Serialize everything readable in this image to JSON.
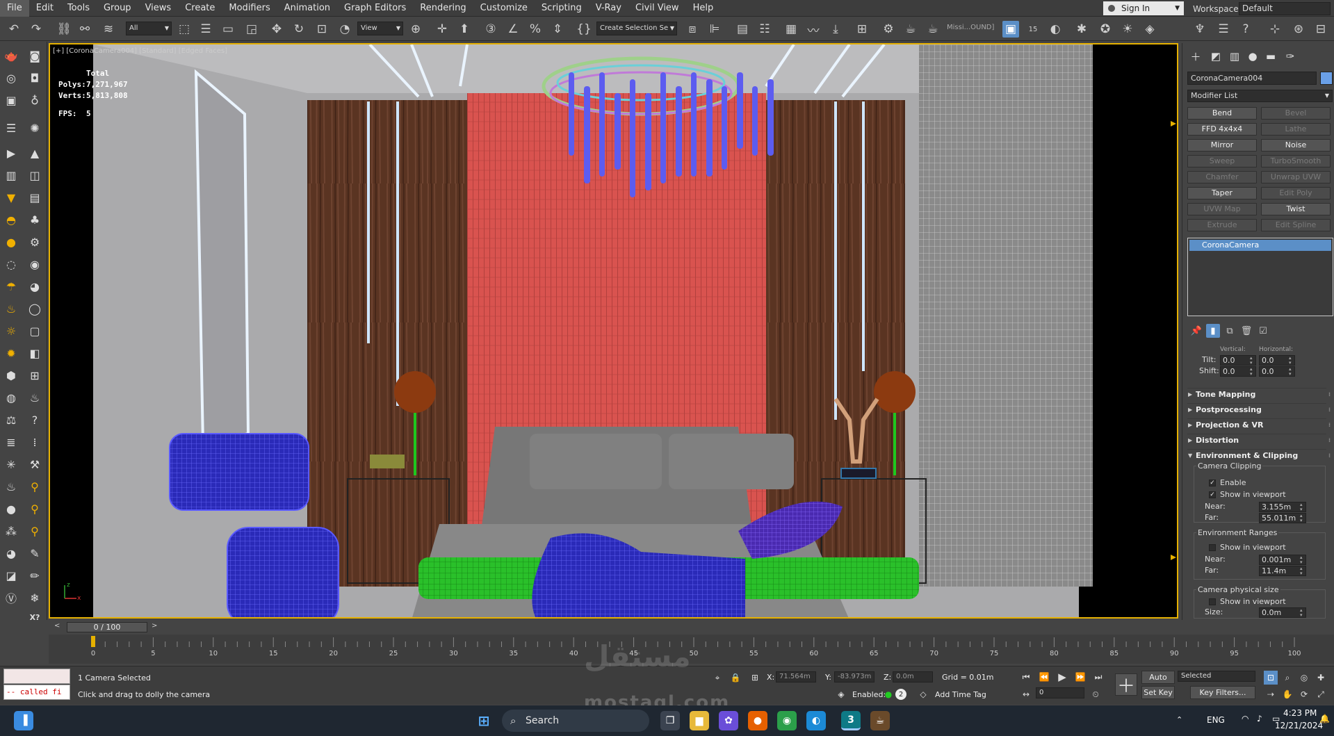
{
  "menu": [
    "File",
    "Edit",
    "Tools",
    "Group",
    "Views",
    "Create",
    "Modifiers",
    "Animation",
    "Graph Editors",
    "Rendering",
    "Customize",
    "Scripting",
    "V-Ray",
    "Civil View",
    "Help"
  ],
  "account": {
    "sign_in": "Sign In",
    "workspaces_label": "Workspaces:",
    "workspace": "Default"
  },
  "toolbar": {
    "selection_filter": "All",
    "ref_coord": "View",
    "named_selection": "Create Selection Se",
    "missing_label": "Missi...OUND]",
    "frame_badge": "15"
  },
  "viewport": {
    "label": "[+] [CoronaCamera004] [Standard] [Edged Faces]",
    "stats": {
      "header": "Total",
      "polys_label": "Polys:",
      "polys": "7,271,967",
      "verts_label": "Verts:",
      "verts": "5,813,808",
      "fps_label": "FPS:",
      "fps": "5"
    },
    "axis_x": "x",
    "axis_z": "z"
  },
  "command_panel": {
    "object_name": "CoronaCamera004",
    "object_color": "#6aa0e8",
    "modifier_list": "Modifier List",
    "modifiers": [
      {
        "label": "Bend",
        "enabled": true
      },
      {
        "label": "Bevel",
        "enabled": false
      },
      {
        "label": "FFD 4x4x4",
        "enabled": true
      },
      {
        "label": "Lathe",
        "enabled": false
      },
      {
        "label": "Mirror",
        "enabled": true
      },
      {
        "label": "Noise",
        "enabled": true
      },
      {
        "label": "Sweep",
        "enabled": false
      },
      {
        "label": "TurboSmooth",
        "enabled": false
      },
      {
        "label": "Chamfer",
        "enabled": false
      },
      {
        "label": "Unwrap UVW",
        "enabled": false
      },
      {
        "label": "Taper",
        "enabled": true
      },
      {
        "label": "Edit Poly",
        "enabled": false
      },
      {
        "label": "UVW Map",
        "enabled": false
      },
      {
        "label": "Twist",
        "enabled": true
      },
      {
        "label": "Extrude",
        "enabled": false
      },
      {
        "label": "Edit Spline",
        "enabled": false
      }
    ],
    "stack_item": "CoronaCamera",
    "partial_labels": {
      "vertical": "Vertical:",
      "horizontal": "Horizontal:"
    },
    "tilt": {
      "label": "Tilt:",
      "v": "0.0",
      "h": "0.0"
    },
    "shift": {
      "label": "Shift:",
      "v": "0.0",
      "h": "0.0"
    },
    "rollouts": [
      "Tone Mapping",
      "Postprocessing",
      "Projection & VR",
      "Distortion",
      "Environment & Clipping"
    ],
    "camera_clipping": {
      "title": "Camera Clipping",
      "enable": "Enable",
      "show": "Show in viewport",
      "near_label": "Near:",
      "near": "3.155m",
      "far_label": "Far:",
      "far": "55.011m"
    },
    "env_ranges": {
      "title": "Environment Ranges",
      "show": "Show in viewport",
      "near_label": "Near:",
      "near": "0.001m",
      "far_label": "Far:",
      "far": "11.4m"
    },
    "phys_size": {
      "title": "Camera physical size",
      "show": "Show in viewport",
      "size_label": "Size:",
      "size": "0.0m"
    }
  },
  "timeline": {
    "frame_display": "0 / 100",
    "ticks": [
      "0",
      "5",
      "10",
      "15",
      "20",
      "25",
      "30",
      "35",
      "40",
      "45",
      "50",
      "55",
      "60",
      "65",
      "70",
      "75",
      "80",
      "85",
      "90",
      "95",
      "100"
    ]
  },
  "status": {
    "maxscript_error": "-- called fi",
    "selection": "1 Camera Selected",
    "prompt": "Click and drag to dolly the camera",
    "x_label": "X:",
    "x": "71.564m",
    "y_label": "Y:",
    "y": "-83.973m",
    "z_label": "Z:",
    "z": "0.0m",
    "grid": "Grid = 0.01m",
    "enabled_label": "Enabled:",
    "enabled_count": "2",
    "add_time_tag": "Add Time Tag",
    "auto_key": "Auto Key",
    "key_mode": "Selected",
    "set_key": "Set Key",
    "key_filters": "Key Filters...",
    "current_frame": "0"
  },
  "taskbar": {
    "search": "Search",
    "max_badge": "3",
    "lang": "ENG",
    "time": "4:23 PM",
    "date": "12/21/2024"
  },
  "watermark": {
    "arabic": "مستقل",
    "latin": "mostaql.com"
  }
}
